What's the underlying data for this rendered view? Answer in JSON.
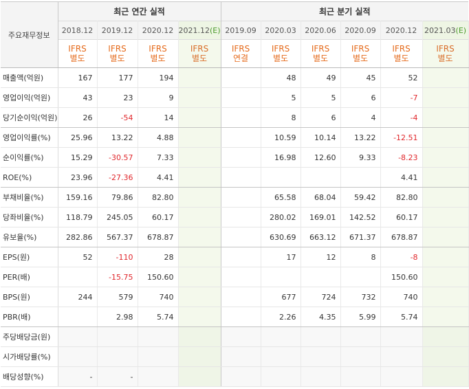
{
  "header": {
    "row_label": "주요재무정보",
    "annual_title": "최근 연간 실적",
    "quarterly_title": "최근 분기 실적"
  },
  "annual_periods": [
    {
      "label": "2018.12",
      "estimate": false,
      "std_line1": "IFRS",
      "std_line2": "별도"
    },
    {
      "label": "2019.12",
      "estimate": false,
      "std_line1": "IFRS",
      "std_line2": "별도"
    },
    {
      "label": "2020.12",
      "estimate": false,
      "std_line1": "IFRS",
      "std_line2": "별도"
    },
    {
      "label": "2021.12",
      "estimate": true,
      "est_mark": "(E)",
      "std_line1": "IFRS",
      "std_line2": "별도"
    }
  ],
  "quarterly_periods": [
    {
      "label": "2019.09",
      "estimate": false,
      "std_line1": "IFRS",
      "std_line2": "연결"
    },
    {
      "label": "2020.03",
      "estimate": false,
      "std_line1": "IFRS",
      "std_line2": "별도"
    },
    {
      "label": "2020.06",
      "estimate": false,
      "std_line1": "IFRS",
      "std_line2": "별도"
    },
    {
      "label": "2020.09",
      "estimate": false,
      "std_line1": "IFRS",
      "std_line2": "별도"
    },
    {
      "label": "2020.12",
      "estimate": false,
      "std_line1": "IFRS",
      "std_line2": "별도"
    },
    {
      "label": "2021.03",
      "estimate": true,
      "est_mark": "(E)",
      "std_line1": "IFRS",
      "std_line2": "별도"
    }
  ],
  "rows": [
    {
      "label": "매출액(억원)",
      "group_end": false,
      "values": [
        "167",
        "177",
        "194",
        "",
        "",
        "48",
        "49",
        "45",
        "52",
        ""
      ]
    },
    {
      "label": "영업이익(억원)",
      "group_end": false,
      "values": [
        "43",
        "23",
        "9",
        "",
        "",
        "5",
        "5",
        "6",
        "-7",
        ""
      ]
    },
    {
      "label": "당기순이익(억원)",
      "group_end": true,
      "values": [
        "26",
        "-54",
        "14",
        "",
        "",
        "8",
        "6",
        "4",
        "-4",
        ""
      ]
    },
    {
      "label": "영업이익률(%)",
      "group_end": false,
      "values": [
        "25.96",
        "13.22",
        "4.88",
        "",
        "",
        "10.59",
        "10.14",
        "13.22",
        "-12.51",
        ""
      ]
    },
    {
      "label": "순이익률(%)",
      "group_end": false,
      "values": [
        "15.29",
        "-30.57",
        "7.33",
        "",
        "",
        "16.98",
        "12.60",
        "9.33",
        "-8.23",
        ""
      ]
    },
    {
      "label": "ROE(%)",
      "group_end": true,
      "values": [
        "23.96",
        "-27.36",
        "4.41",
        "",
        "",
        "",
        "",
        "",
        "4.41",
        ""
      ]
    },
    {
      "label": "부채비율(%)",
      "group_end": false,
      "values": [
        "159.16",
        "79.86",
        "82.80",
        "",
        "",
        "65.58",
        "68.04",
        "59.42",
        "82.80",
        ""
      ]
    },
    {
      "label": "당좌비율(%)",
      "group_end": false,
      "values": [
        "118.79",
        "245.05",
        "60.17",
        "",
        "",
        "280.02",
        "169.01",
        "142.52",
        "60.17",
        ""
      ]
    },
    {
      "label": "유보율(%)",
      "group_end": true,
      "values": [
        "282.86",
        "567.37",
        "678.87",
        "",
        "",
        "630.69",
        "663.12",
        "671.37",
        "678.87",
        ""
      ]
    },
    {
      "label": "EPS(원)",
      "group_end": false,
      "values": [
        "52",
        "-110",
        "28",
        "",
        "",
        "17",
        "12",
        "8",
        "-8",
        ""
      ]
    },
    {
      "label": "PER(배)",
      "group_end": false,
      "values": [
        "",
        "-15.75",
        "150.60",
        "",
        "",
        "",
        "",
        "",
        "150.60",
        ""
      ]
    },
    {
      "label": "BPS(원)",
      "group_end": false,
      "values": [
        "244",
        "579",
        "740",
        "",
        "",
        "677",
        "724",
        "732",
        "740",
        ""
      ]
    },
    {
      "label": "PBR(배)",
      "group_end": true,
      "values": [
        "",
        "2.98",
        "5.74",
        "",
        "",
        "2.26",
        "4.35",
        "5.99",
        "5.74",
        ""
      ]
    },
    {
      "label": "주당배당금(원)",
      "group_end": false,
      "empty": true,
      "values": [
        "",
        "",
        "",
        "",
        "",
        "",
        "",
        "",
        "",
        ""
      ]
    },
    {
      "label": "시가배당률(%)",
      "group_end": false,
      "empty": true,
      "values": [
        "",
        "",
        "",
        "",
        "",
        "",
        "",
        "",
        "",
        ""
      ]
    },
    {
      "label": "배당성향(%)",
      "group_end": false,
      "empty": true,
      "values": [
        "-",
        "-",
        "",
        "",
        "",
        "",
        "",
        "",
        "",
        ""
      ]
    }
  ]
}
